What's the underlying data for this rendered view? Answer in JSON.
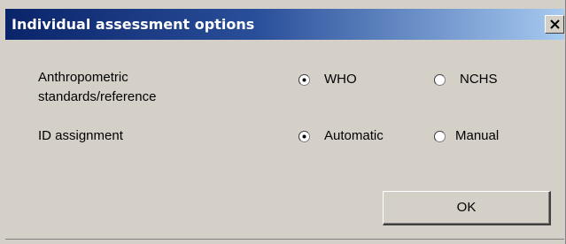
{
  "window": {
    "title": "Individual assessment options",
    "close_label": "X"
  },
  "anthropometric": {
    "label_line1": "Anthropometric",
    "label_line2": "standards/reference",
    "options": [
      {
        "label": "WHO",
        "selected": true
      },
      {
        "label": "NCHS",
        "selected": false
      }
    ]
  },
  "id_assignment": {
    "label": "ID assignment",
    "options": [
      {
        "label": "Automatic",
        "selected": true
      },
      {
        "label": "Manual",
        "selected": false
      }
    ]
  },
  "buttons": {
    "ok_label": "OK"
  },
  "colors": {
    "dialog_bg": "#d4d0c8",
    "title_gradient_start": "#0a246a",
    "title_gradient_end": "#a6caf0"
  }
}
